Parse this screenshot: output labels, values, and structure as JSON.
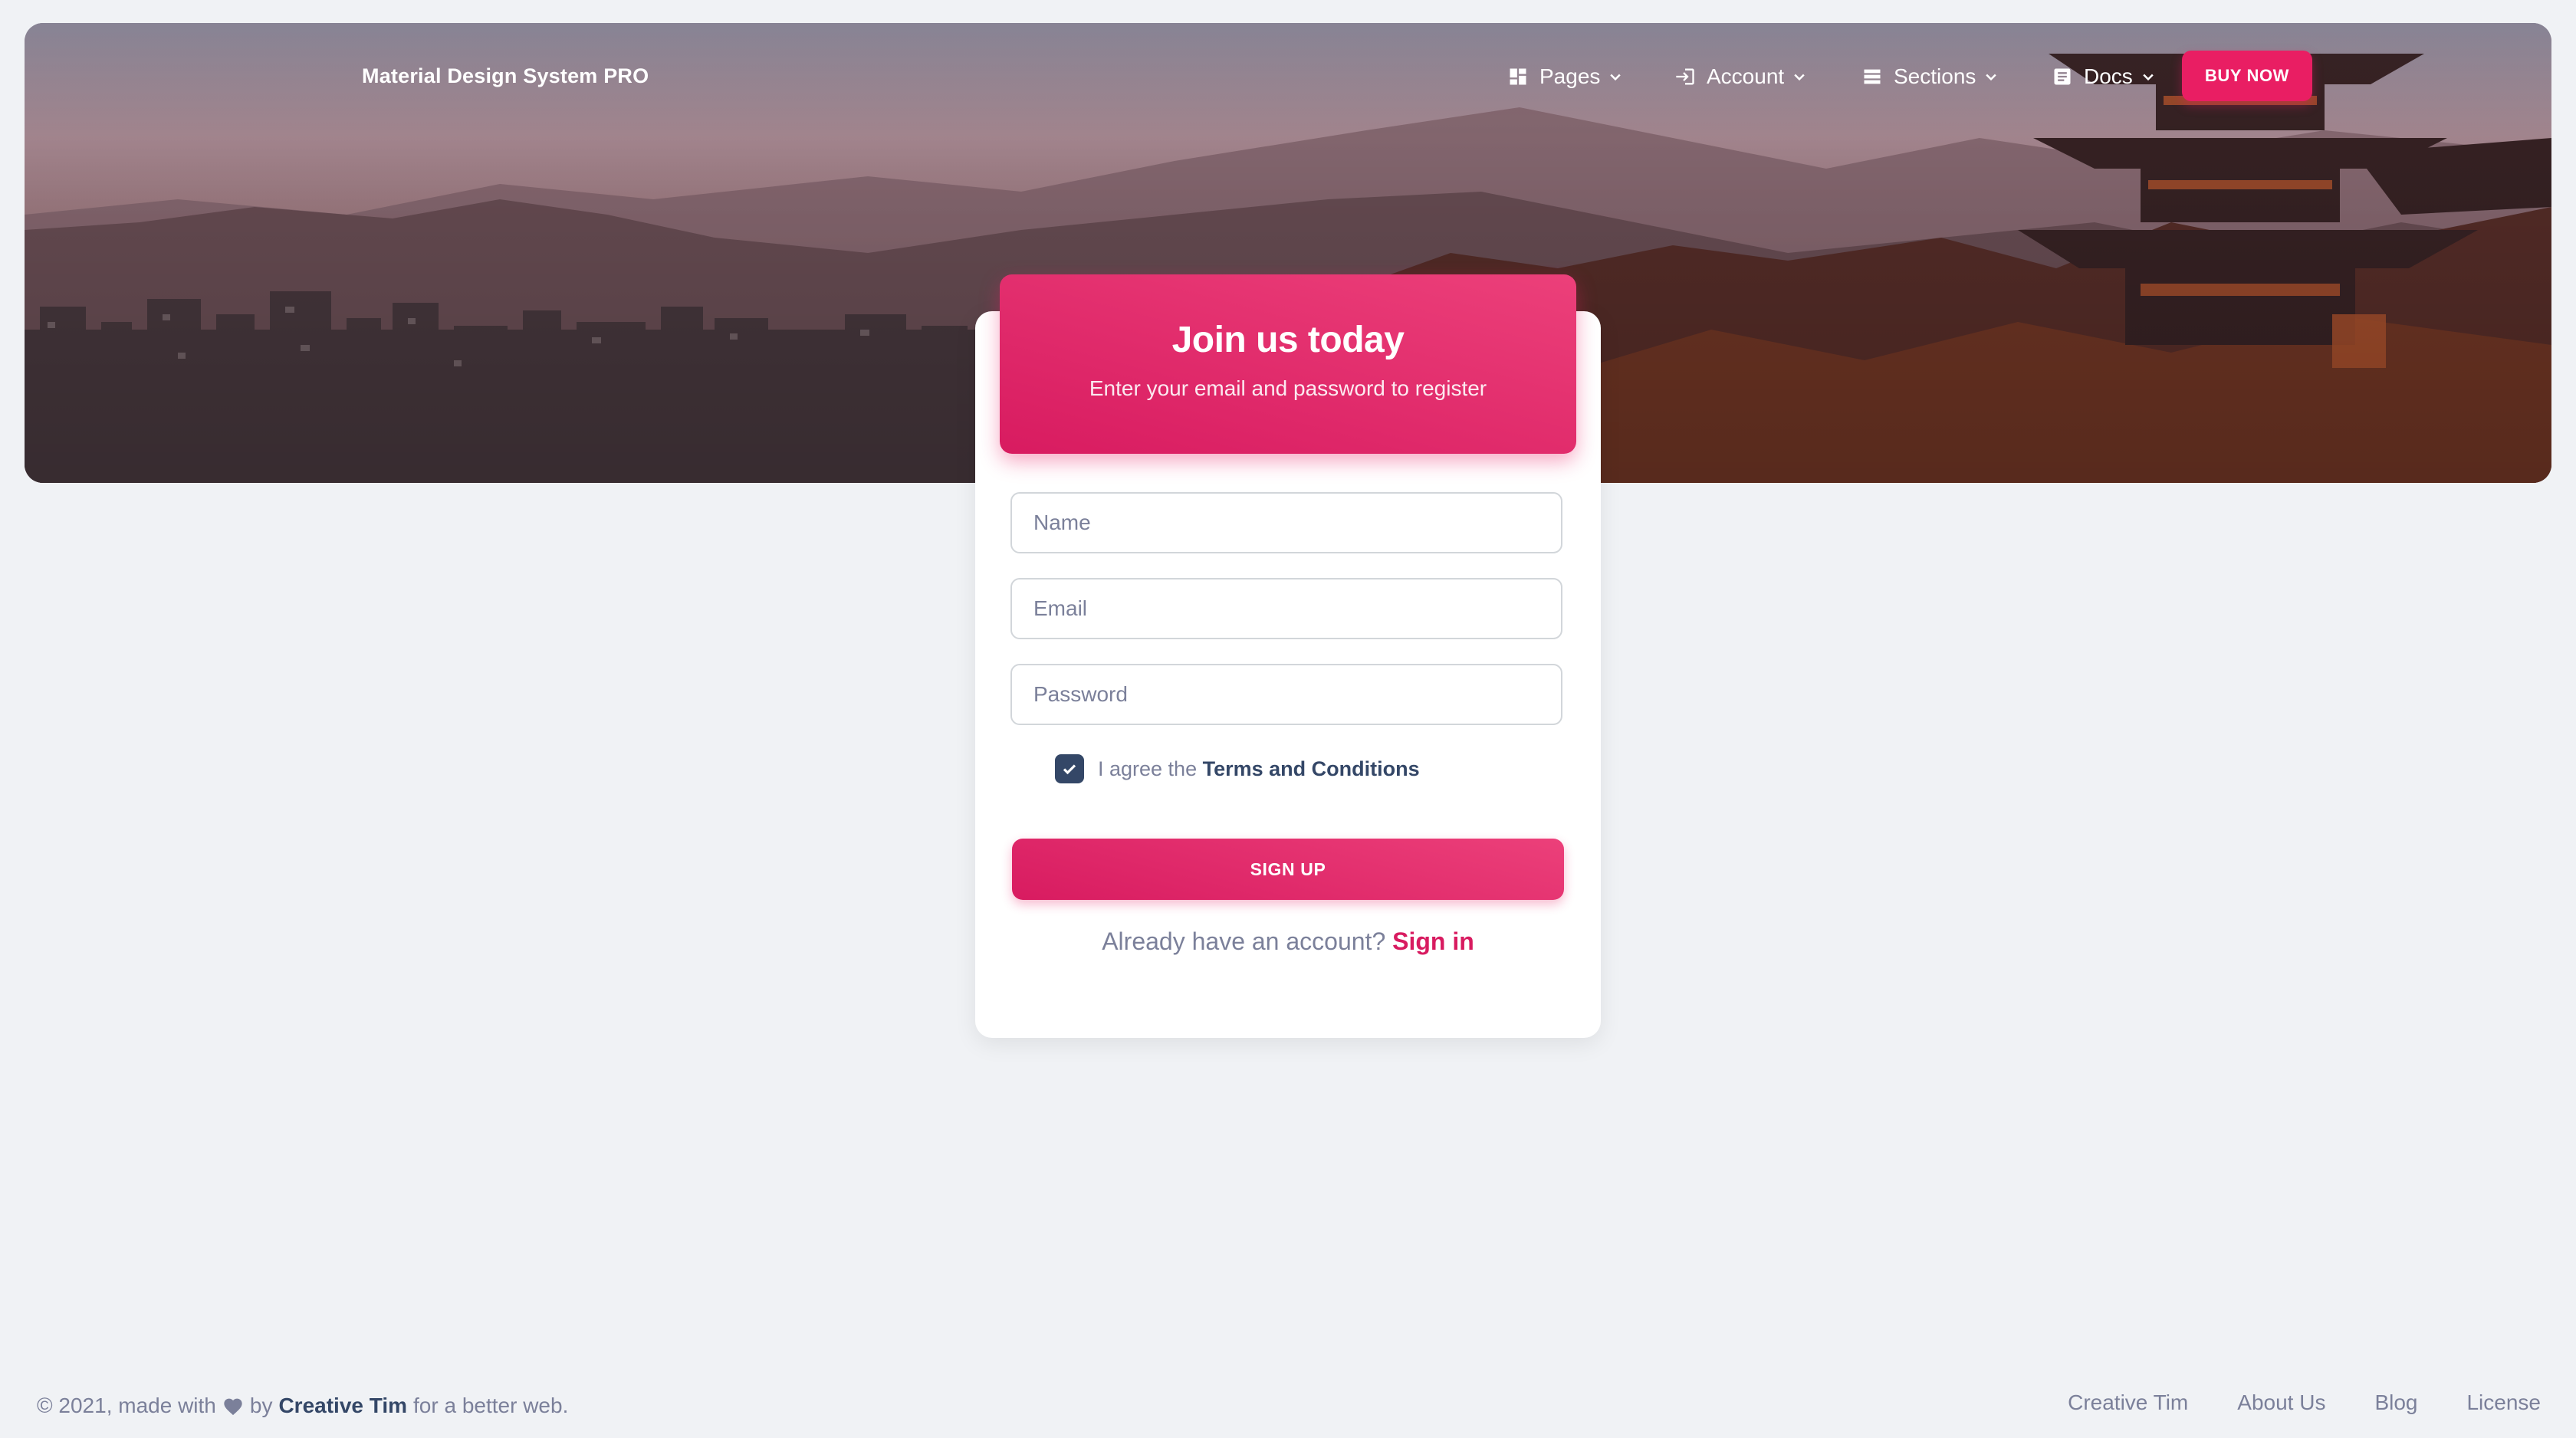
{
  "navbar": {
    "brand": "Material Design System PRO",
    "items": [
      {
        "label": "Pages",
        "icon": "dashboard-icon"
      },
      {
        "label": "Account",
        "icon": "login-icon"
      },
      {
        "label": "Sections",
        "icon": "view-list-icon"
      },
      {
        "label": "Docs",
        "icon": "article-icon"
      }
    ],
    "buy_now": "BUY NOW"
  },
  "card": {
    "title": "Join us today",
    "subtitle": "Enter your email and password to register",
    "fields": {
      "name_placeholder": "Name",
      "email_placeholder": "Email",
      "password_placeholder": "Password"
    },
    "terms": {
      "prefix": "I agree the",
      "link": "Terms and Conditions",
      "checked": true
    },
    "signup_label": "SIGN UP",
    "have_account_text": "Already have an account?",
    "signin_link": "Sign in"
  },
  "footer": {
    "copyright_prefix": "© 2021, made with",
    "by_text": "by",
    "author": "Creative Tim",
    "suffix": "for a better web.",
    "links": [
      "Creative Tim",
      "About Us",
      "Blog",
      "License"
    ]
  },
  "colors": {
    "accent": "#e91e63",
    "text_dark": "#344767",
    "text_muted": "#7b809a",
    "background": "#f0f2f5"
  }
}
